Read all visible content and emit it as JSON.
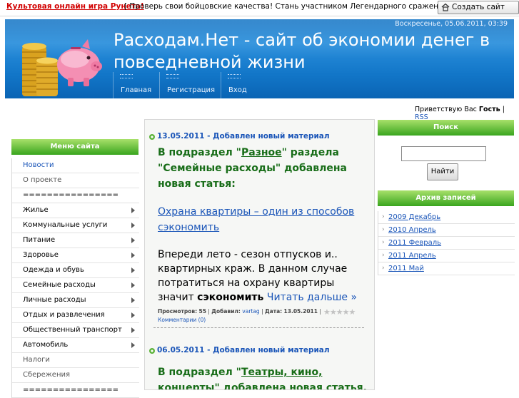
{
  "topbar": {
    "game_link": "Культовая онлайн игра Рунета!",
    "promo_text": "[ Проверь свои бойцовские качества! Стань участником Легендарного сражения! ]",
    "create_site_label": "Создать сайт"
  },
  "header": {
    "date": "Воскресенье, 05.06.2011, 03:39",
    "title": "Расходам.Нет - сайт об экономии денег в повседневной жизни",
    "nav": [
      "Главная",
      "Регистрация",
      "Вход"
    ]
  },
  "greeting": {
    "prefix": "Приветствую Вас",
    "user": "Гость",
    "divider": "|",
    "rss": "RSS"
  },
  "left_menu": {
    "title": "Меню сайта",
    "items": [
      {
        "label": "Новости",
        "has_arrow": false
      },
      {
        "label": "О проекте",
        "has_arrow": false
      },
      {
        "label": "================",
        "has_arrow": false
      },
      {
        "label": "Жилье",
        "has_arrow": true
      },
      {
        "label": "Коммунальные услуги",
        "has_arrow": true
      },
      {
        "label": "Питание",
        "has_arrow": true
      },
      {
        "label": "Здоровье",
        "has_arrow": true
      },
      {
        "label": "Одежда и обувь",
        "has_arrow": true
      },
      {
        "label": "Семейные расходы",
        "has_arrow": true
      },
      {
        "label": "Личные расходы",
        "has_arrow": true
      },
      {
        "label": "Отдых и развлечения",
        "has_arrow": true
      },
      {
        "label": "Общественный транспорт",
        "has_arrow": true
      },
      {
        "label": "Автомобиль",
        "has_arrow": true
      },
      {
        "label": "Налоги",
        "has_arrow": false
      },
      {
        "label": "Сбережения",
        "has_arrow": false
      },
      {
        "label": "================",
        "has_arrow": false
      }
    ]
  },
  "posts": [
    {
      "date_line": "13.05.2011 - Добавлен новый материал",
      "head_prefix": "В подраздел \"",
      "head_link": "Разное",
      "head_suffix": "\" раздела \"Семейные расходы\" добавлена новая статья:",
      "article_link": "Охрана квартиры – один из способов сэкономить",
      "text": "Впереди лето - сезон отпусков и.. квартирных краж. В данном случае потратиться на охрану квартиры значит",
      "text_bold": "сэкономить",
      "read_more": "Читать дальше »",
      "meta_views_label": "Просмотров:",
      "meta_views": "55",
      "meta_added_label": "Добавил:",
      "meta_author": "vartag",
      "meta_date_label": "Дата:",
      "meta_date": "13.05.2011",
      "meta_comments": "Комментарии (0)"
    },
    {
      "date_line": "06.05.2011 - Добавлен новый материал",
      "head_prefix": "В подраздел \"",
      "head_link": "Театры, кино, концерты",
      "head_suffix": "\" добавлена новая статья, о том, как"
    }
  ],
  "search": {
    "title": "Поиск",
    "button_label": "Найти",
    "value": ""
  },
  "archive": {
    "title": "Архив записей",
    "items": [
      "2009 Декабрь",
      "2010 Апрель",
      "2011 Февраль",
      "2011 Апрель",
      "2011 Май"
    ]
  },
  "colors": {
    "header_blue": "#1276c8",
    "menu_green": "#3aa51e",
    "link_blue": "#1a55b8",
    "heading_green": "#186d18",
    "promo_red": "#d10000"
  }
}
